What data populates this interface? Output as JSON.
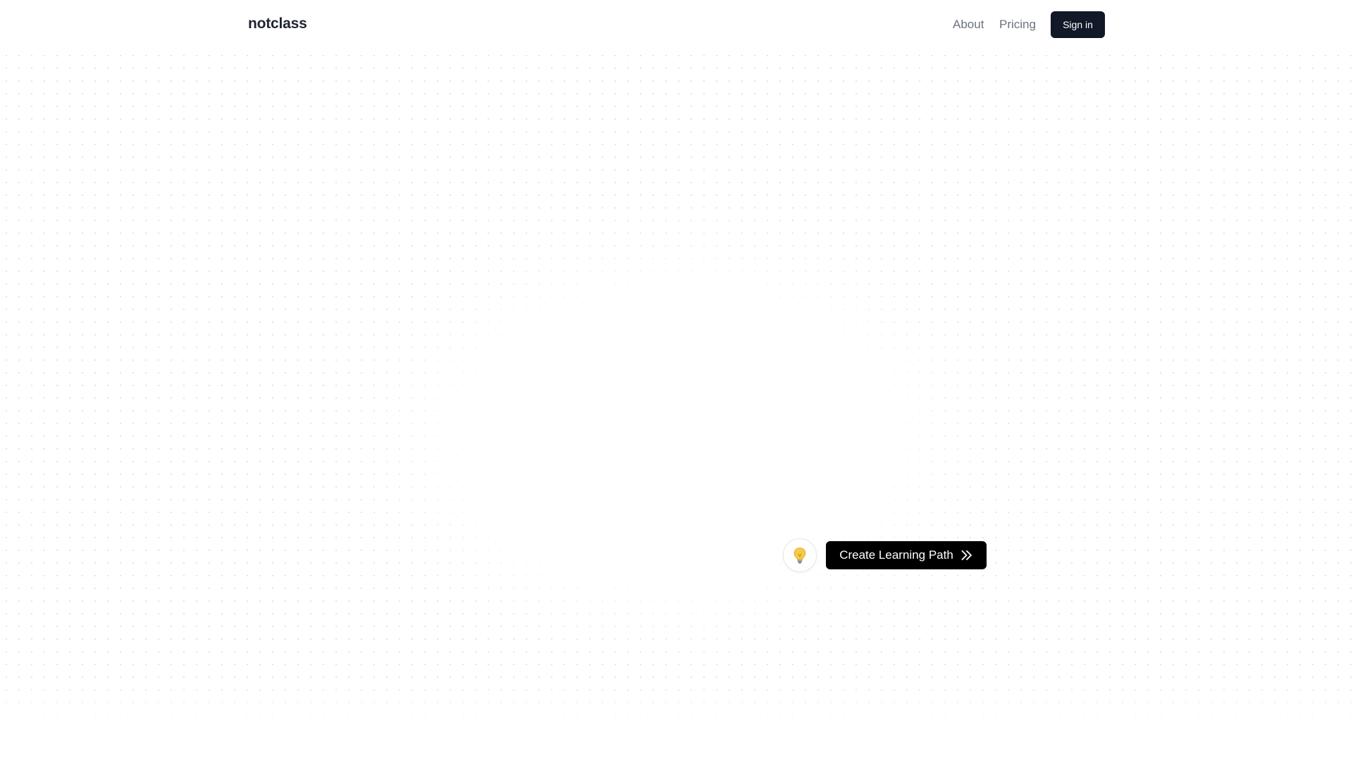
{
  "header": {
    "brand": "notclass",
    "nav": {
      "about": "About",
      "pricing": "Pricing"
    },
    "sign_in_label": "Sign in"
  },
  "actions": {
    "hint_icon": "lightbulb-icon",
    "create_label": "Create Learning Path",
    "create_icon": "double-chevron-right-icon"
  },
  "colors": {
    "primary_dark": "#111827",
    "button_black": "#000000",
    "nav_text": "#6b7280",
    "bulb_yellow": "#f7c948"
  }
}
